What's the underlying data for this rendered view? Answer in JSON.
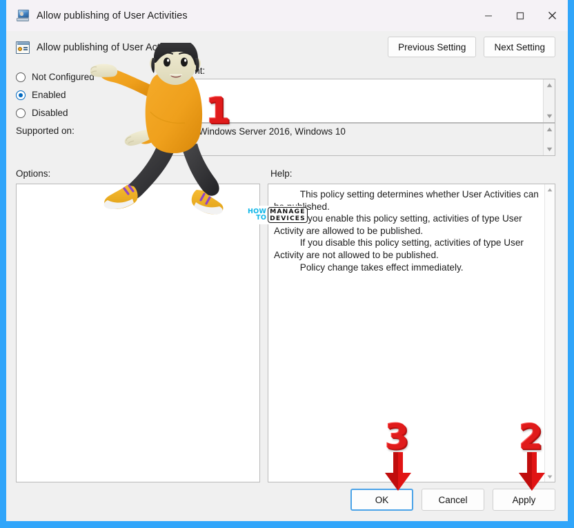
{
  "window": {
    "title": "Allow publishing of User Activities",
    "title_icon": "computer-monitor-icon",
    "minimize_label": "—",
    "maximize_label": "□",
    "close_label": "✕"
  },
  "header": {
    "policy_icon": "group-policy-setting-icon",
    "policy_name": "Allow publishing of User Activities",
    "previous_setting_label": "Previous Setting",
    "next_setting_label": "Next Setting"
  },
  "settings": {
    "radios": [
      {
        "label": "Not Configured",
        "selected": false
      },
      {
        "label": "Enabled",
        "selected": true
      },
      {
        "label": "Disabled",
        "selected": false
      }
    ],
    "comment_label": "Comment:",
    "comment_value": "",
    "supported_label": "Supported on:",
    "supported_value": "At least Windows Server 2016, Windows 10"
  },
  "panels": {
    "options_label": "Options:",
    "options_content": "",
    "help_label": "Help:",
    "help_text": "          This policy setting determines whether User Activities can be published.\n          If you enable this policy setting, activities of type User Activity are allowed to be published.\n          If you disable this policy setting, activities of type User Activity are not allowed to be published.\n          Policy change takes effect immediately."
  },
  "footer": {
    "ok_label": "OK",
    "cancel_label": "Cancel",
    "apply_label": "Apply"
  },
  "annotations": {
    "step1": "1",
    "step2": "2",
    "step3": "3"
  },
  "watermark": {
    "how": "HOW",
    "to": "TO",
    "manage": "MANAGE",
    "devices": "DEVICES"
  },
  "colors": {
    "desktop_blue": "#30a5fa",
    "accent_blue": "#0069c0",
    "focus_blue": "#4aa3e8",
    "annotation_red": "#e01b1b",
    "window_bg": "#f0f0f0"
  }
}
